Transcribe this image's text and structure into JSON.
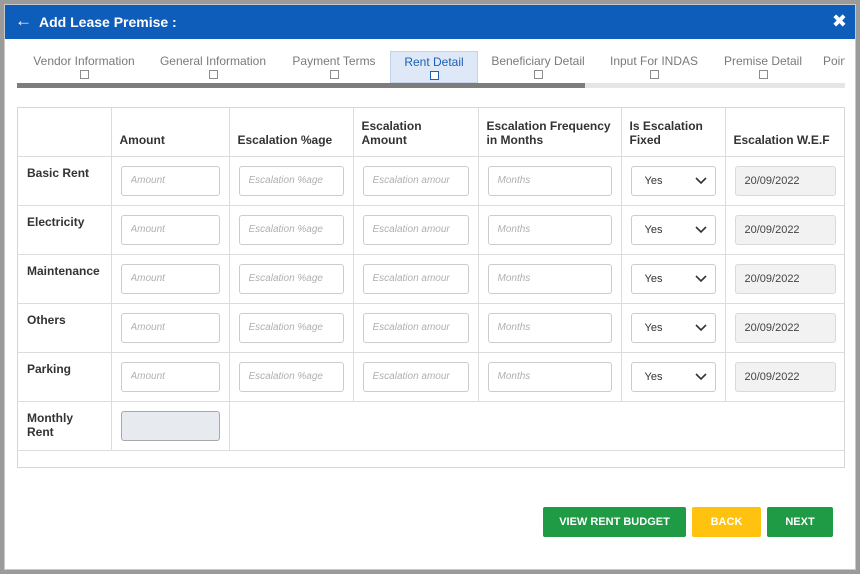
{
  "header": {
    "title": "Add Lease Premise :",
    "back_icon": "←",
    "close_icon": "✖",
    "color": "#0f5dbb"
  },
  "tabs": [
    {
      "label": "Vendor Information"
    },
    {
      "label": "General Information"
    },
    {
      "label": "Payment Terms"
    },
    {
      "label": "Rent Detail",
      "active": true
    },
    {
      "label": "Beneficiary Detail"
    },
    {
      "label": "Input For INDAS"
    },
    {
      "label": "Premise Detail"
    },
    {
      "label": "Poin"
    }
  ],
  "table": {
    "columns": [
      "",
      "Amount",
      "Escalation %age",
      "Escalation Amount",
      "Escalation Frequency in Months",
      "Is Escalation Fixed",
      "Escalation W.E.F"
    ],
    "placeholders": {
      "amount": "Amount",
      "escalation_pct": "Escalation %age",
      "escalation_amount": "Escalation amour",
      "frequency": "Months"
    },
    "rows": [
      {
        "label": "Basic Rent",
        "fixed": "Yes",
        "wef": "20/09/2022"
      },
      {
        "label": "Electricity",
        "fixed": "Yes",
        "wef": "20/09/2022"
      },
      {
        "label": "Maintenance",
        "fixed": "Yes",
        "wef": "20/09/2022"
      },
      {
        "label": "Others",
        "fixed": "Yes",
        "wef": "20/09/2022"
      },
      {
        "label": "Parking",
        "fixed": "Yes",
        "wef": "20/09/2022"
      }
    ],
    "monthly_rent_label": "Monthly Rent"
  },
  "buttons": {
    "view_rent_budget": {
      "label": "VIEW RENT BUDGET",
      "color": "#1f9a45"
    },
    "back": {
      "label": "BACK",
      "color": "#ffc30f"
    },
    "next": {
      "label": "NEXT",
      "color": "#1f9a45"
    }
  }
}
